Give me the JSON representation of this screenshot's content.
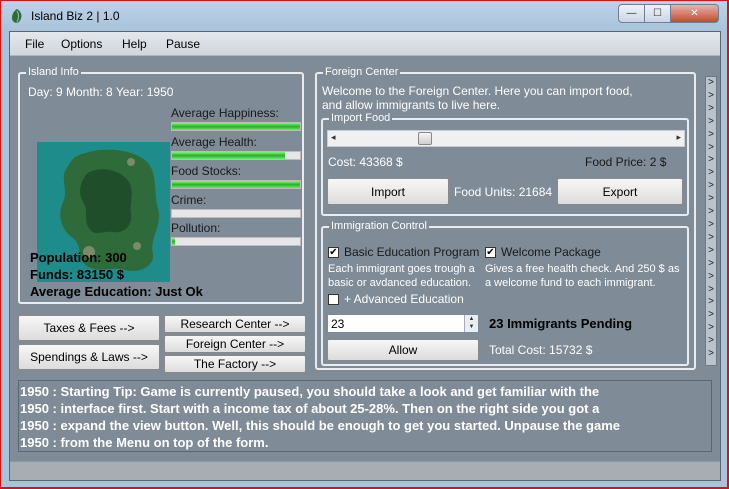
{
  "window": {
    "title": "Island Biz 2 | 1.0"
  },
  "caption": {
    "minimize": "—",
    "maximize": "☐",
    "close": "✕"
  },
  "menu": {
    "items": [
      "File",
      "Options",
      "Help",
      "Pause"
    ]
  },
  "island_info": {
    "title": "Island Info",
    "date": "Day: 9 Month: 8 Year: 1950",
    "stats": [
      {
        "label": "Average Happiness:",
        "value": 1.0
      },
      {
        "label": "Average Health:",
        "value": 0.88
      },
      {
        "label": "Food Stocks:",
        "value": 1.0
      },
      {
        "label": "Crime:",
        "value": 0.0
      },
      {
        "label": "Pollution:",
        "value": 0.02
      }
    ],
    "population": "Population: 300",
    "funds": "Funds: 83150 $",
    "education": "Average Education: Just Ok"
  },
  "nav_buttons": {
    "taxes": "Taxes & Fees -->",
    "spendings": "Spendings & Laws -->",
    "research": "Research Center -->",
    "foreign": "Foreign Center -->",
    "factory": "The Factory -->"
  },
  "foreign_center": {
    "title": "Foreign Center",
    "welcome": "Welcome to the Foreign Center. Here you can import food, and allow immigrants to live here.",
    "import_food": {
      "title": "Import Food",
      "scroll_position": 0.24,
      "cost": "Cost: 43368 $",
      "food_price": "Food Price: 2 $",
      "import_label": "Import",
      "export_label": "Export",
      "food_units": "Food Units: 21684"
    },
    "immigration": {
      "title": "Immigration Control",
      "basic_education_label": "Basic Education Program",
      "basic_education_checked": true,
      "basic_education_desc": "Each immigrant goes trough a basic or avdanced education.",
      "advanced_education_label": "+ Advanced Education",
      "advanced_education_checked": false,
      "welcome_package_label": "Welcome Package",
      "welcome_package_checked": true,
      "welcome_package_desc": "Gives a free health check. And 250 $ as a welcome fund to each immigrant.",
      "count_value": "23",
      "pending": "23 Immigrants Pending",
      "allow_label": "Allow",
      "total_cost": "Total Cost: 15732 $"
    }
  },
  "expand_button": {
    "glyph": ">",
    "count": 22
  },
  "log": {
    "lines": [
      "1950 : Starting Tip: Game is currently paused, you should take a look and get familiar with the",
      "1950 : interface first. Start with a income tax of about 25-28%. Then on the right side you got a",
      "1950 : expand the view button. Well, this should be enough to get you started. Unpause the game",
      "1950 : from the Menu on top of the form."
    ]
  },
  "colors": {
    "panel": "#7f8b97",
    "border": "#e8ecf0",
    "bar_fill": "#1fb51f",
    "map_water": "#1f8c8c",
    "map_land": "#2f6b3a"
  }
}
